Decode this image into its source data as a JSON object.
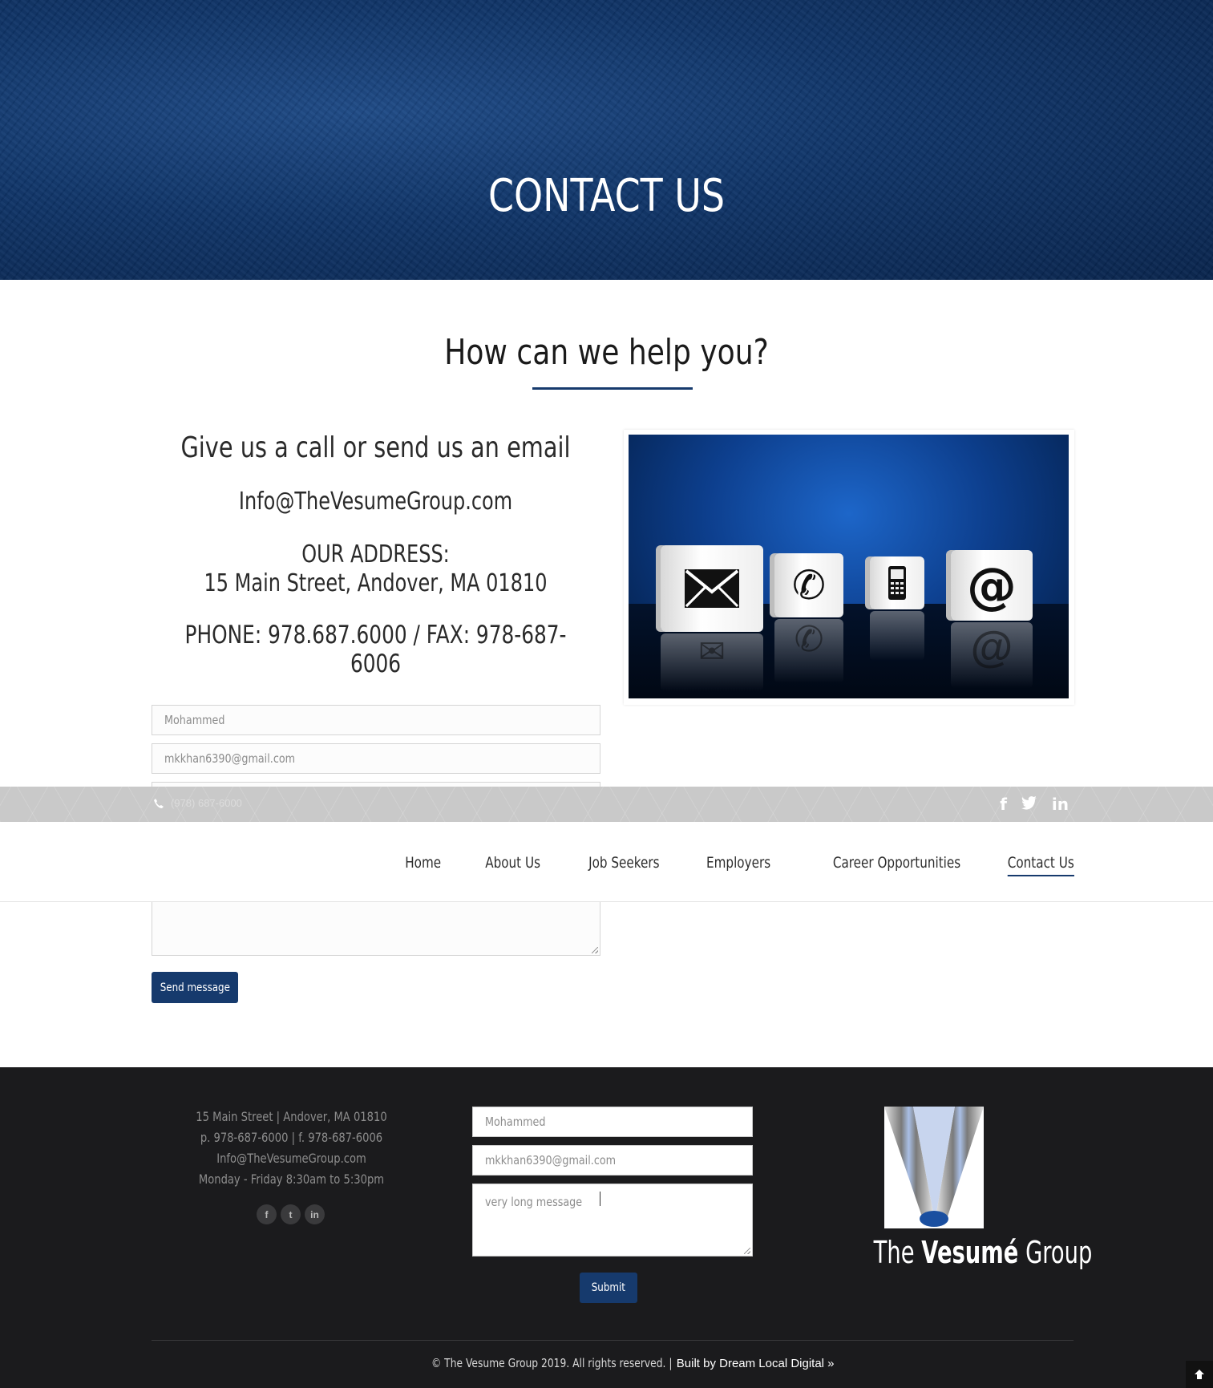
{
  "hero": {
    "title": "CONTACT US"
  },
  "section": {
    "heading": "How can we help you?",
    "call_line": "Give us a call or send us an email",
    "email": "Info@TheVesumeGroup.com",
    "address_label": "OUR ADDRESS:",
    "address": "15 Main Street, Andover, MA 01810",
    "phone_fax": "PHONE: 978.687.6000 / FAX: 978-687-6006"
  },
  "form": {
    "name_value": "Mohammed",
    "email_value": "mkkhan6390@gmail.com",
    "send_label": "Send message"
  },
  "topbar": {
    "phone": "(978) 687-6000",
    "social_icons": [
      "facebook-icon",
      "twitter-icon",
      "linkedin-icon"
    ]
  },
  "nav": {
    "items": [
      "Home",
      "About Us",
      "Job Seekers",
      "Employers",
      "Career Opportunities",
      "Contact Us"
    ],
    "active": "Contact Us"
  },
  "footer": {
    "address": "15 Main Street | Andover, MA 01810",
    "phones": "p. 978-687-6000 | f. 978-687-6006",
    "email": "Info@TheVesumeGroup.com",
    "hours": "Monday - Friday 8:30am to 5:30pm",
    "social": [
      "f",
      "t",
      "in"
    ],
    "form": {
      "name_value": "Mohammed",
      "email_value": "mkkhan6390@gmail.com",
      "message_value": "very long message",
      "submit_label": "Submit"
    },
    "logo": {
      "the": "The",
      "vesume": "Vesumé",
      "group": "Group"
    },
    "copyright": "© The Vesume Group 2019. All rights reserved. |",
    "built_by": "Built by Dream Local Digital »"
  },
  "colors": {
    "brand": "#163a6d",
    "footer_bg": "#1b1b1d",
    "hero_bg": "#0f3468"
  }
}
